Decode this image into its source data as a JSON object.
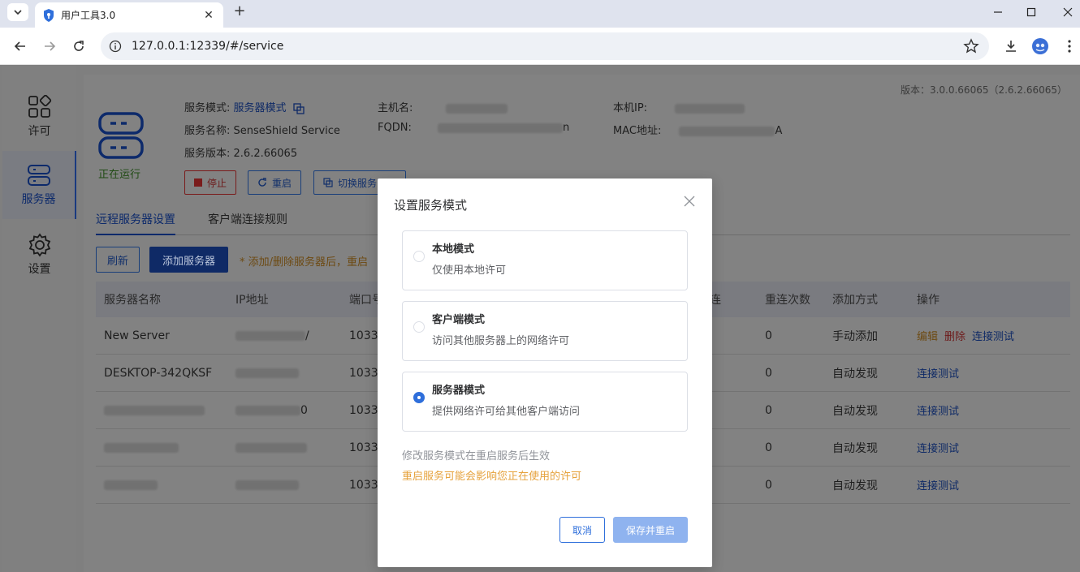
{
  "browser": {
    "tab_title": "用户工具3.0",
    "url": "127.0.0.1:12339/#/service"
  },
  "sidebar": {
    "items": [
      {
        "label": "许可",
        "icon": "grid-icon"
      },
      {
        "label": "服务器",
        "icon": "server-icon"
      },
      {
        "label": "设置",
        "icon": "gear-icon"
      }
    ]
  },
  "header": {
    "version": "版本：3.0.0.66065（2.6.2.66065）",
    "status": "正在运行",
    "service_mode_key": "服务模式:",
    "service_mode_value": "服务器模式",
    "service_name_key": "服务名称:",
    "service_name_value": "SenseShield Service",
    "service_version_key": "服务版本:",
    "service_version_value": "2.6.2.66065",
    "hostname_key": "主机名:",
    "fqdn_key": "FQDN:",
    "fqdn_tail": "n",
    "local_ip_key": "本机IP:",
    "mac_key": "MAC地址:",
    "mac_tail": "A",
    "stop_label": "停止",
    "restart_label": "重启",
    "switch_label": "切换服务"
  },
  "tabs": {
    "remote": "远程服务器设置",
    "client_rules": "客户端连接规则"
  },
  "actions": {
    "refresh": "刷新",
    "add_server": "添加服务器",
    "warning": "* 添加/删除服务器后，重启"
  },
  "table": {
    "columns": [
      "服务器名称",
      "IP地址",
      "端口号",
      "连",
      "重连次数",
      "添加方式",
      "操作"
    ],
    "rows": [
      {
        "name": "New Server",
        "ip_tail": "/",
        "port": "1033",
        "retries": "0",
        "method": "手动添加",
        "ops": [
          "编辑",
          "删除",
          "连接测试"
        ]
      },
      {
        "name": "DESKTOP-342QKSF",
        "ip_tail": "",
        "port": "1033",
        "retries": "0",
        "method": "自动发现",
        "ops": [
          "连接测试"
        ]
      },
      {
        "name": "",
        "ip_tail": "0",
        "port": "1033",
        "retries": "0",
        "method": "自动发现",
        "ops": [
          "连接测试"
        ]
      },
      {
        "name": "",
        "ip_tail": "",
        "port": "1033",
        "retries": "0",
        "method": "自动发现",
        "ops": [
          "连接测试"
        ]
      },
      {
        "name": "",
        "ip_tail": "",
        "port": "1033",
        "retries": "0",
        "method": "自动发现",
        "ops": [
          "连接测试"
        ]
      }
    ]
  },
  "modal": {
    "title": "设置服务模式",
    "options": [
      {
        "title": "本地模式",
        "desc": "仅使用本地许可",
        "checked": false
      },
      {
        "title": "客户端模式",
        "desc": "访问其他服务器上的网络许可",
        "checked": false
      },
      {
        "title": "服务器模式",
        "desc": "提供网络许可给其他客户端访问",
        "checked": true
      }
    ],
    "note": "修改服务模式在重启服务后生效",
    "warning": "重启服务可能会影响您正在使用的许可",
    "cancel": "取消",
    "save": "保存并重启"
  }
}
